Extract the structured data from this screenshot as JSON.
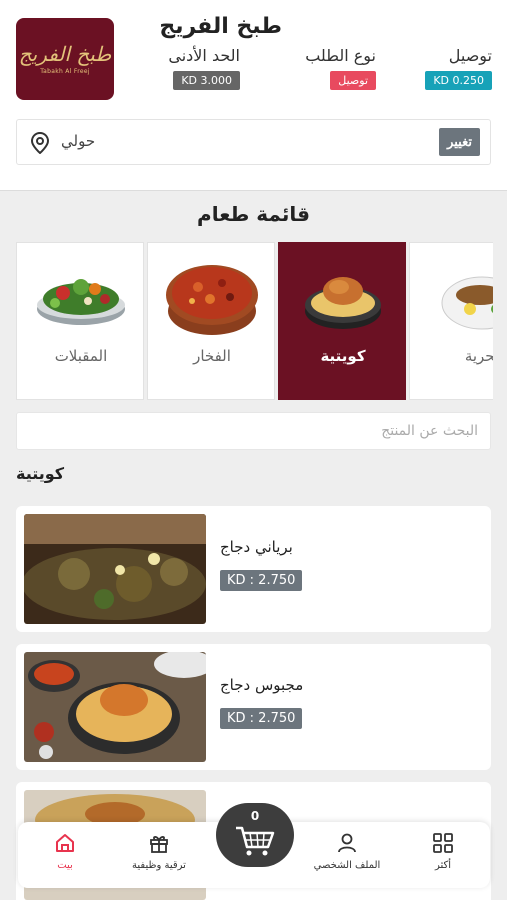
{
  "store": {
    "name": "طبخ الفريج",
    "logo_text_ar": "طبخ الفريج",
    "logo_text_en": "Tabakh Al Freej",
    "min_order_label": "الحد الأدنى",
    "min_order_value": "3.000 KD",
    "order_type_label": "نوع الطلب",
    "order_type_value": "توصيل",
    "delivery_label": "توصيل",
    "delivery_value": "0.250 KD"
  },
  "location": {
    "area": "حولي",
    "change_label": "تغيير"
  },
  "menu": {
    "title": "قائمة طعام",
    "categories": [
      {
        "label": "المقبلات",
        "active": false
      },
      {
        "label": "الفخار",
        "active": false
      },
      {
        "label": "كويتية",
        "active": true
      },
      {
        "label": "بحرية",
        "active": false
      }
    ],
    "search_placeholder": "البحث عن المنتج",
    "selected_category": "كويتية"
  },
  "products": [
    {
      "name": "برياني دجاج",
      "price": "KD : 2.750"
    },
    {
      "name": "مجبوس دجاج",
      "price": "KD : 2.750"
    }
  ],
  "nav": {
    "home": "بيت",
    "upgrade": "ترقية وظيفية",
    "profile": "الملف الشخصي",
    "more": "أكثر",
    "cart_count": "0"
  },
  "colors": {
    "brand": "#6b1123",
    "active_nav": "#e8344e",
    "teal_pill": "#17a2b8",
    "red_pill": "#e84a5f",
    "gray_pill": "#666666"
  }
}
